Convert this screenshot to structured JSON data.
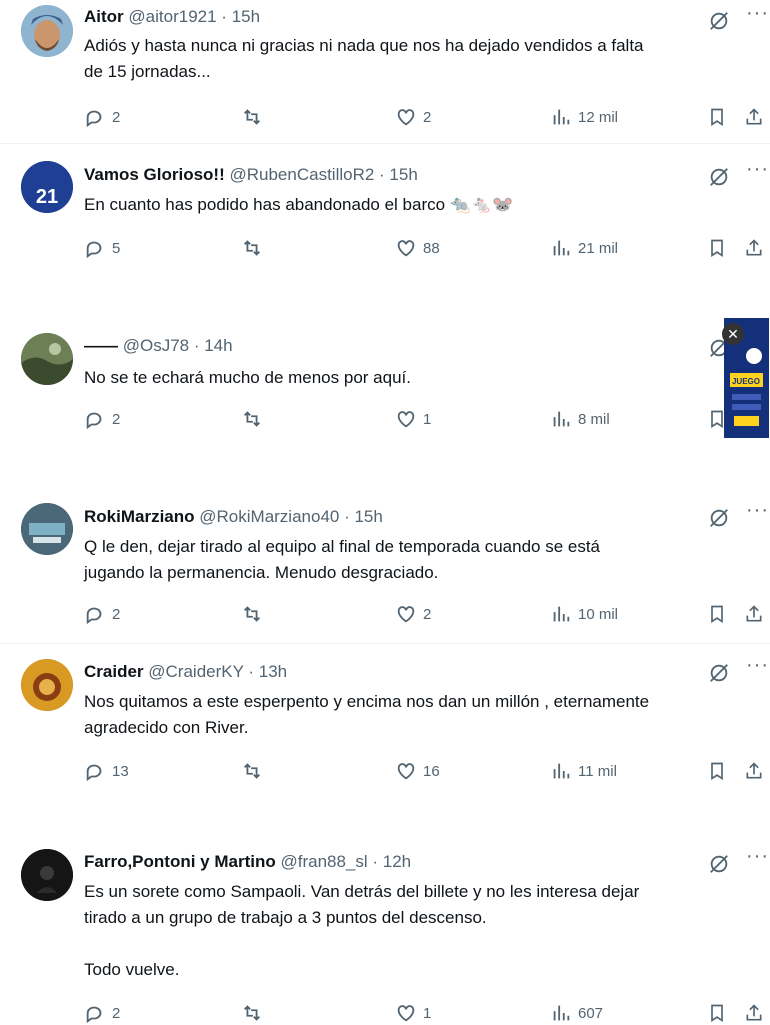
{
  "tweets": [
    {
      "name": "Aitor",
      "handle": "@aitor1921 · 15h",
      "text": "Adiós y hasta nunca ni gracias ni nada que nos ha dejado vendidos a falta\nde 15 jornadas...",
      "replies": "2",
      "likes": "2",
      "views": "12 mil"
    },
    {
      "name": "Vamos Glorioso!!",
      "handle": "@RubenCastilloR2 · 15h",
      "text": "En cuanto has podido has abandonado el barco 🐀🐁🐭",
      "replies": "5",
      "likes": "88",
      "views": "21 mil",
      "avatar_text": "21"
    },
    {
      "name": "——",
      "handle": "@OsJ78 · 14h",
      "text": "No se te echará mucho de menos por aquí.",
      "replies": "2",
      "likes": "1",
      "views": "8 mil"
    },
    {
      "name": "RokiMarziano",
      "handle": "@RokiMarziano40 · 15h",
      "text": "Q le den, dejar tirado al equipo al final de temporada cuando se está\njugando la permanencia. Menudo desgraciado.",
      "replies": "2",
      "likes": "2",
      "views": "10 mil"
    },
    {
      "name": "Craider",
      "handle": "@CraiderKY · 13h",
      "text": "Nos quitamos a este esperpento y encima nos dan un millón , eternamente\nagradecido con River.",
      "replies": "13",
      "likes": "16",
      "views": "11 mil"
    },
    {
      "name": "Farro,Pontoni y Martino",
      "handle": "@fran88_sl · 12h",
      "text": "Es un sorete como Sampaoli. Van detrás del billete y no les interesa dejar\ntirado a un grupo de trabajo a 3 puntos del descenso.\n\nTodo vuelve.",
      "replies": "2",
      "likes": "1",
      "views": "607"
    }
  ],
  "ad": {
    "label": "JUEGO",
    "close": "✕"
  },
  "icons": [
    "reply-icon",
    "retweet-icon",
    "like-icon",
    "views-icon",
    "bookmark-icon",
    "share-icon",
    "grok-icon",
    "more-icon"
  ]
}
